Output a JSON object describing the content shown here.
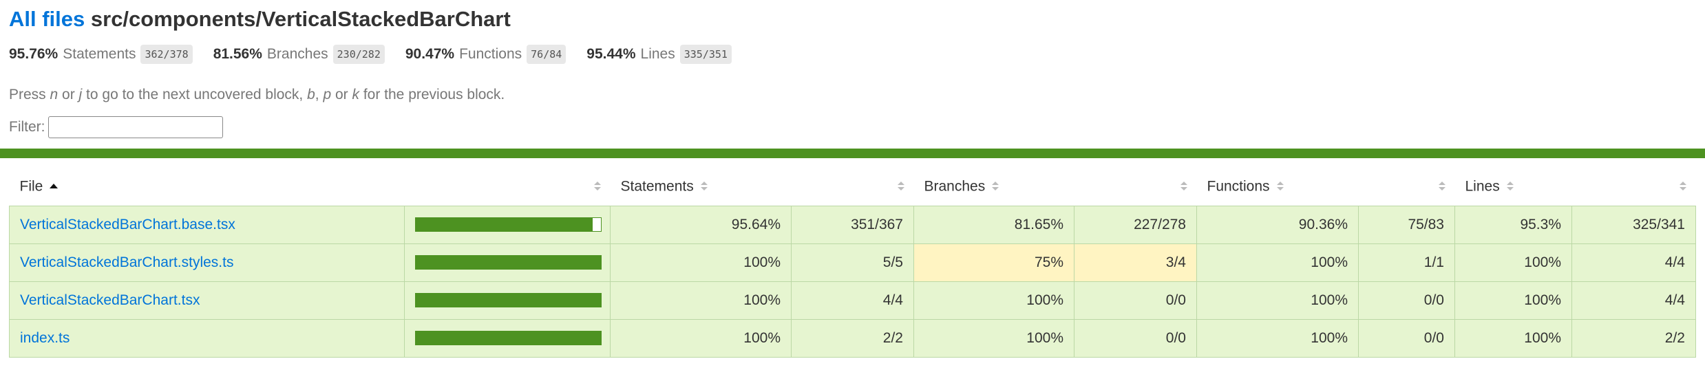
{
  "header": {
    "all_files_link": "All files",
    "path": "src/components/VerticalStackedBarChart"
  },
  "summary": [
    {
      "pct": "95.76%",
      "label": "Statements",
      "fraction": "362/378"
    },
    {
      "pct": "81.56%",
      "label": "Branches",
      "fraction": "230/282"
    },
    {
      "pct": "90.47%",
      "label": "Functions",
      "fraction": "76/84"
    },
    {
      "pct": "95.44%",
      "label": "Lines",
      "fraction": "335/351"
    }
  ],
  "help": {
    "t1": "Press ",
    "k1": "n",
    "t2": " or ",
    "k2": "j",
    "t3": " to go to the next uncovered block, ",
    "k3": "b",
    "t4": ", ",
    "k4": "p",
    "t5": " or ",
    "k5": "k",
    "t6": " for the previous block."
  },
  "filter": {
    "label": "Filter:",
    "value": ""
  },
  "table": {
    "headers": {
      "file": "File",
      "statements": "Statements",
      "branches": "Branches",
      "functions": "Functions",
      "lines": "Lines"
    },
    "rows": [
      {
        "file": "VerticalStackedBarChart.base.tsx",
        "coverage": 0.9564,
        "stmt_pct": "95.64%",
        "stmt_frac": "351/367",
        "br_pct": "81.65%",
        "br_frac": "227/278",
        "fn_pct": "90.36%",
        "fn_frac": "75/83",
        "ln_pct": "95.3%",
        "ln_frac": "325/341"
      },
      {
        "file": "VerticalStackedBarChart.styles.ts",
        "coverage": 1.0,
        "stmt_pct": "100%",
        "stmt_frac": "5/5",
        "br_pct": "75%",
        "br_frac": "3/4",
        "fn_pct": "100%",
        "fn_frac": "1/1",
        "ln_pct": "100%",
        "ln_frac": "4/4"
      },
      {
        "file": "VerticalStackedBarChart.tsx",
        "coverage": 1.0,
        "stmt_pct": "100%",
        "stmt_frac": "4/4",
        "br_pct": "100%",
        "br_frac": "0/0",
        "fn_pct": "100%",
        "fn_frac": "0/0",
        "ln_pct": "100%",
        "ln_frac": "4/4"
      },
      {
        "file": "index.ts",
        "coverage": 1.0,
        "stmt_pct": "100%",
        "stmt_frac": "2/2",
        "br_pct": "100%",
        "br_frac": "0/0",
        "fn_pct": "100%",
        "fn_frac": "0/0",
        "ln_pct": "100%",
        "ln_frac": "2/2"
      }
    ]
  },
  "colors": {
    "high": "#4d9221",
    "row_bg_high": "#e6f5d0",
    "row_bg_medium": "#fff4c2",
    "link": "#0074d9"
  }
}
